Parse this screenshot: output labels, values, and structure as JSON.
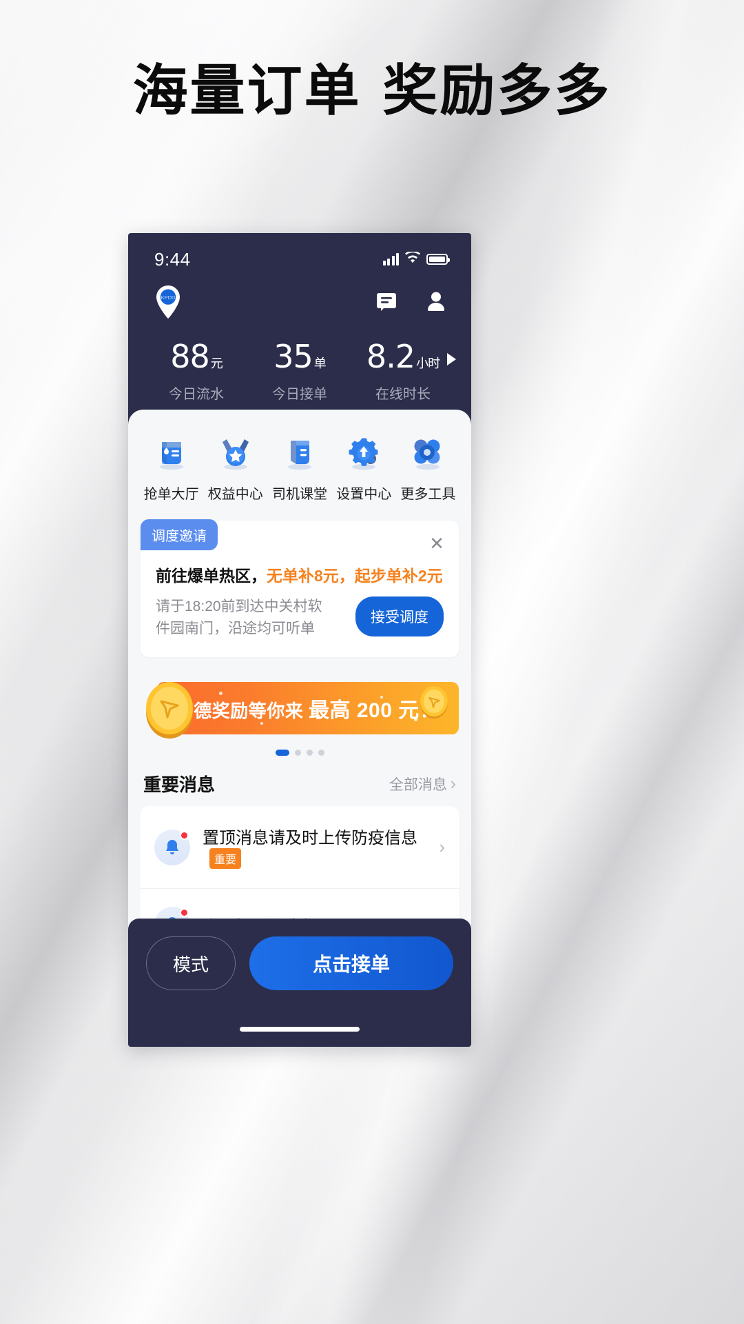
{
  "poster": {
    "headline": "海量订单 奖励多多"
  },
  "colors": {
    "navy": "#2b2d4a",
    "blue": "#1565d8",
    "orange": "#f5821f",
    "tag_blue": "#5b8def",
    "red": "#f5333f"
  },
  "status_bar": {
    "time": "9:44",
    "signal_icon": "signal-bars-icon",
    "wifi_icon": "wifi-icon",
    "battery_icon": "battery-icon"
  },
  "app_header": {
    "logo_text": "KPDD",
    "logo_icon": "map-pin-logo-icon",
    "message_icon": "message-icon",
    "profile_icon": "profile-icon"
  },
  "stats": {
    "items": [
      {
        "value": "88",
        "unit": "元",
        "caption": "今日流水"
      },
      {
        "value": "35",
        "unit": "单",
        "caption": "今日接单"
      },
      {
        "value": "8.2",
        "unit": "小时",
        "caption": "在线时长"
      }
    ],
    "more_arrow": "play-arrow-icon"
  },
  "quick_actions": [
    {
      "label": "抢单大厅",
      "icon": "order-hall-icon"
    },
    {
      "label": "权益中心",
      "icon": "medal-benefits-icon"
    },
    {
      "label": "司机课堂",
      "icon": "driver-class-book-icon"
    },
    {
      "label": "设置中心",
      "icon": "settings-gear-icon"
    },
    {
      "label": "更多工具",
      "icon": "more-tools-icon"
    }
  ],
  "dispatch_card": {
    "tag": "调度邀请",
    "close_icon": "close-icon",
    "title_plain": "前往爆单热区，",
    "title_highlight": "无单补8元，起步单补2元",
    "subtitle": "请于18:20前到达中关村软件园南门，沿途均可听单",
    "accept_button": "接受调度"
  },
  "promo": {
    "text_prefix": "高德奖励等你来 ",
    "text_amount": "最高 200 元！",
    "coin_icon": "gold-coin-icon",
    "dots_total": 4,
    "dots_active": 1
  },
  "messages": {
    "title": "重要消息",
    "all_link": "全部消息",
    "chevron_icon": "chevron-right-icon",
    "items": [
      {
        "icon": "bell-icon",
        "text": "置顶消息请及时上传防疫信息",
        "badge": "重要",
        "chevron": "chevron-right-icon"
      },
      {
        "icon": "bell-icon",
        "text": "今日推送信息标题",
        "badge": "",
        "chevron": ""
      }
    ],
    "floating_icon": "shield-plus-icon"
  },
  "bottom_bar": {
    "mode_button": "模式",
    "accept_button": "点击接单",
    "home_indicator": "home-indicator"
  }
}
